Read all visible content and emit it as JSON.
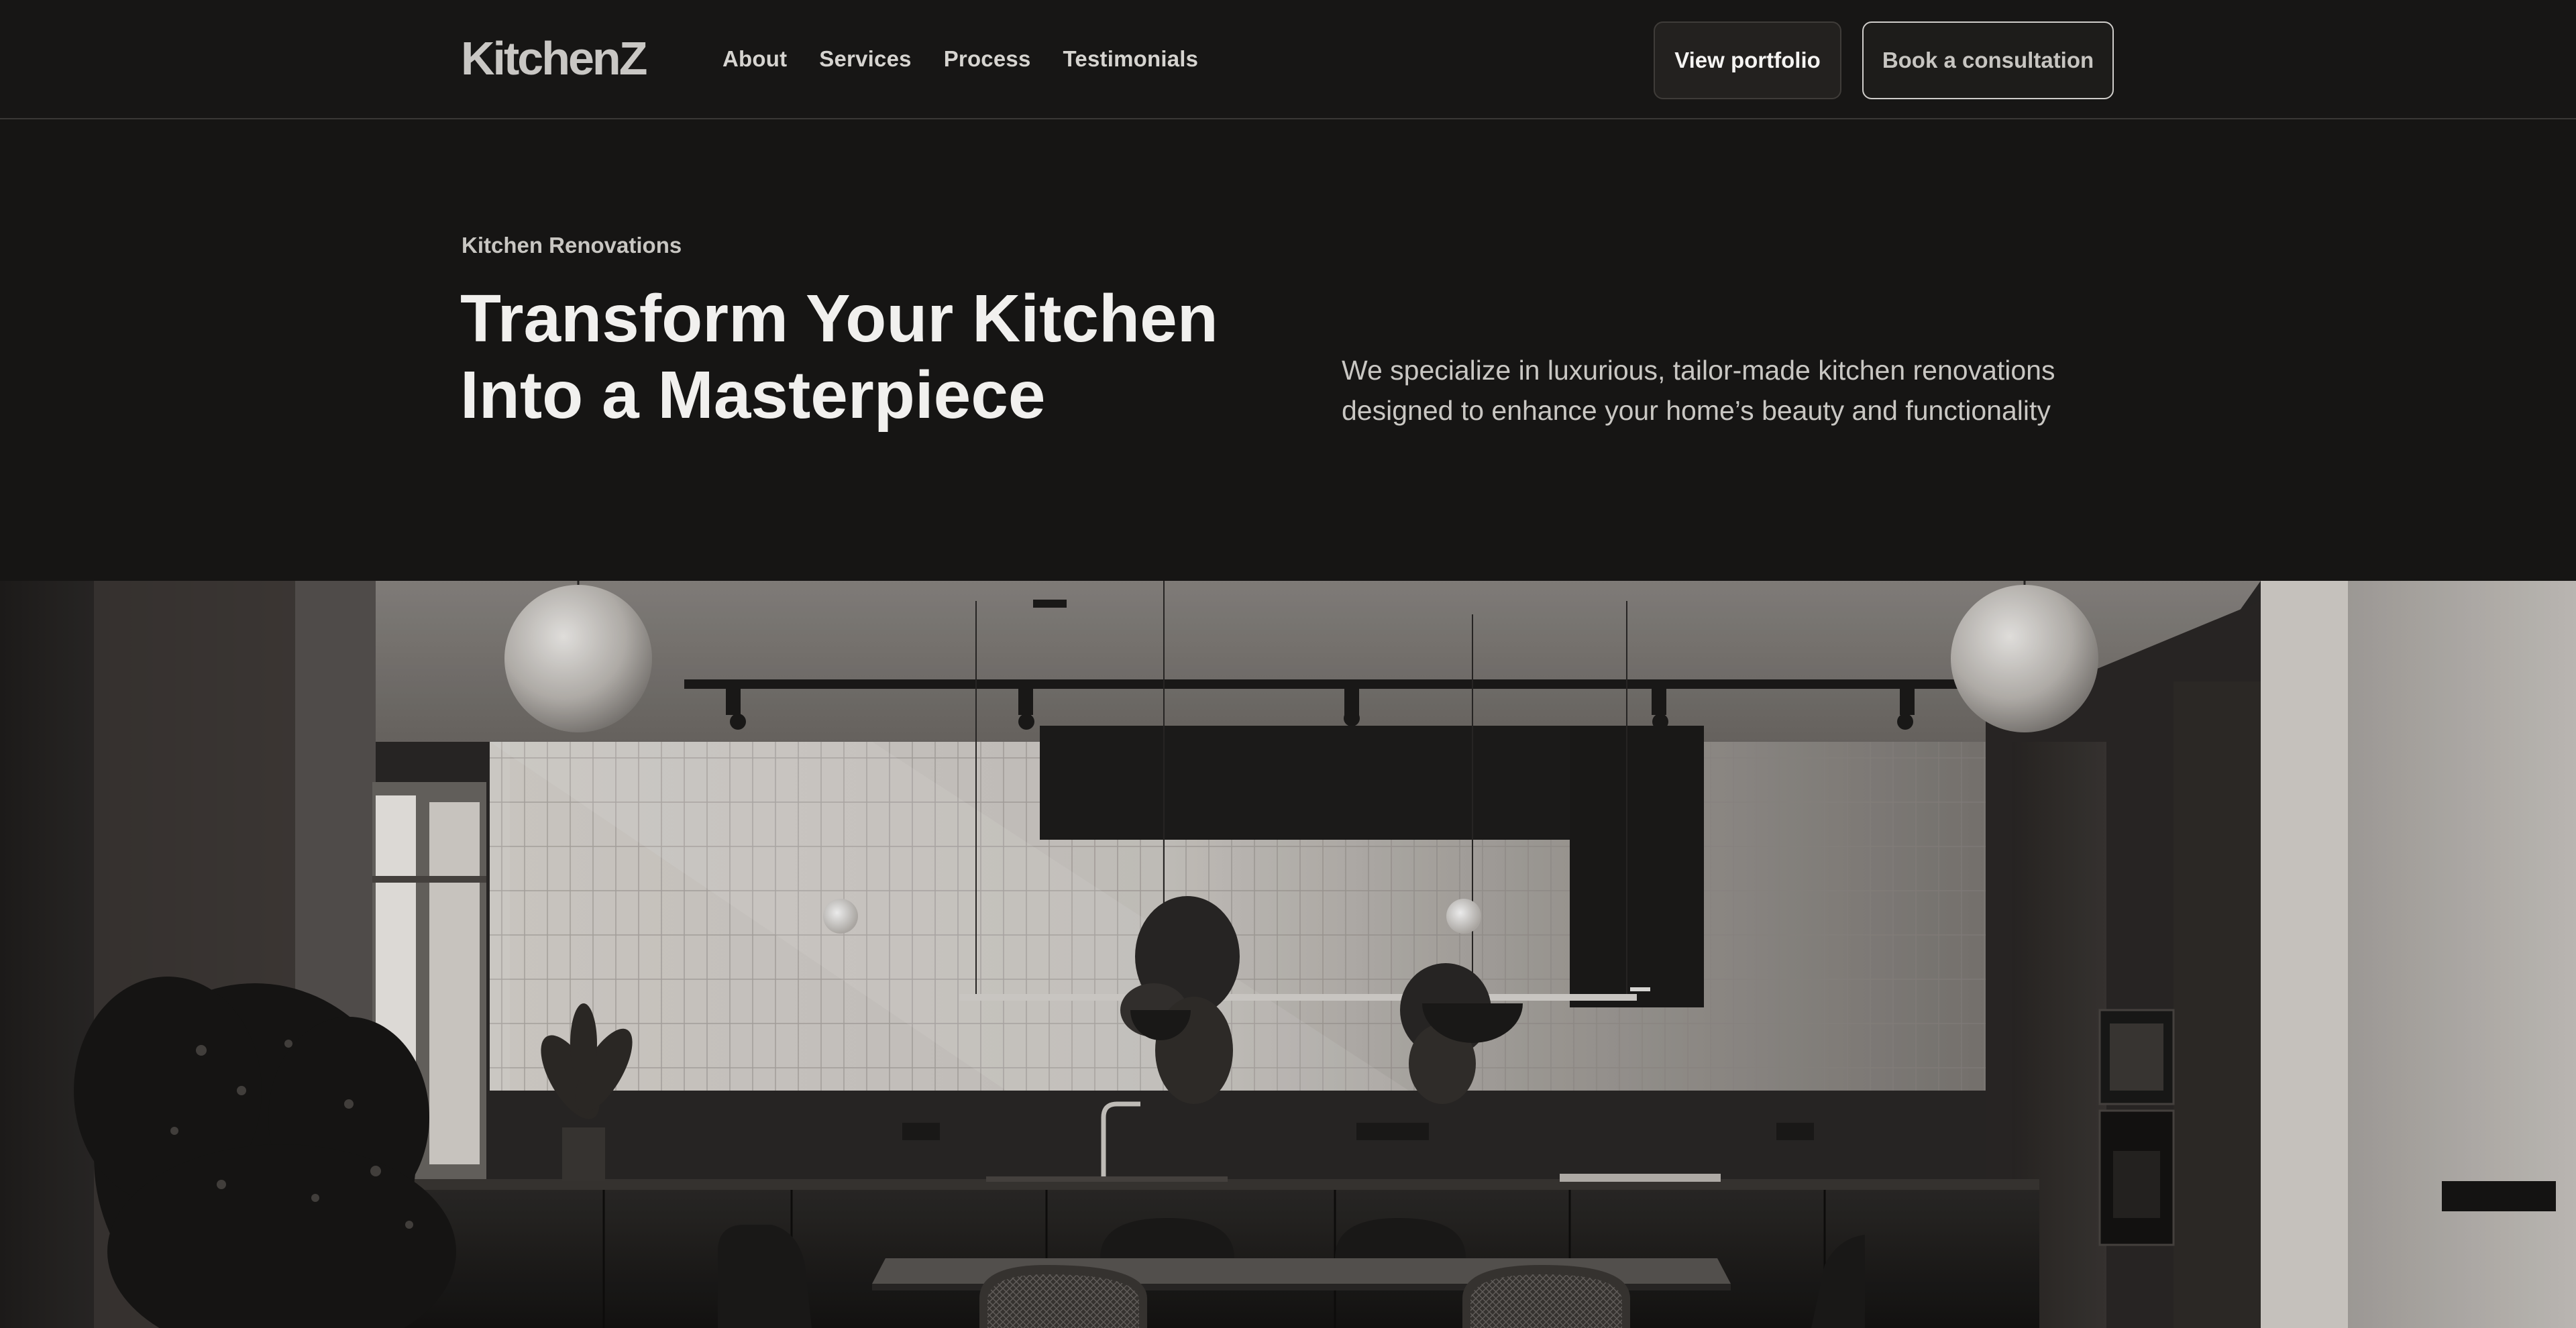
{
  "header": {
    "logo": "KitchenZ",
    "nav": [
      "About",
      "Services",
      "Process",
      "Testimonials"
    ],
    "portfolio_button": "View portfolio",
    "consult_button": "Book a consultation"
  },
  "hero": {
    "eyebrow": "Kitchen Renovations",
    "headline": [
      "Transform Your Kitchen",
      "Into a Masterpiece"
    ],
    "description": [
      "We specialize in luxurious, tailor-made kitchen renovations",
      "designed to enhance your home’s beauty and functionality"
    ]
  },
  "colors": {
    "background": "#161514",
    "text_primary": "#f1f0ee",
    "text_secondary": "#c9c7c3",
    "button_border_light": "#cfcdca"
  }
}
